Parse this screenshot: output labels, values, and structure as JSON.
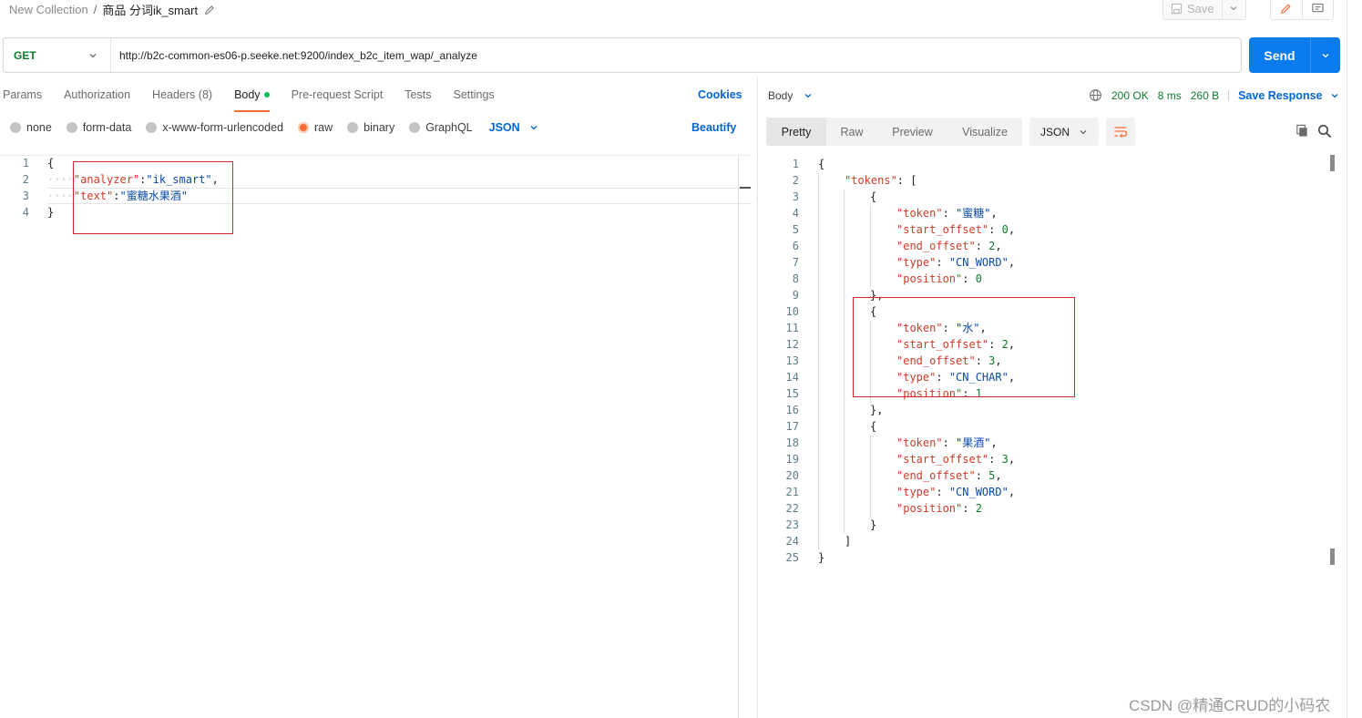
{
  "header": {
    "collection": "New Collection",
    "separator": "/",
    "request_name": "商品 分词ik_smart",
    "save_label": "Save"
  },
  "request": {
    "method": "GET",
    "url": "http://b2c-common-es06-p.seeke.net:9200/index_b2c_item_wap/_analyze",
    "send_label": "Send",
    "tabs": {
      "params": "Params",
      "authorization": "Authorization",
      "headers": "Headers",
      "headers_count": "(8)",
      "body": "Body",
      "pre_request": "Pre-request Script",
      "tests": "Tests",
      "settings": "Settings"
    },
    "cookies_label": "Cookies",
    "body_types": {
      "none": "none",
      "form_data": "form-data",
      "urlencoded": "x-www-form-urlencoded",
      "raw": "raw",
      "binary": "binary",
      "graphql": "GraphQL"
    },
    "selected_body_type": "raw",
    "raw_format": "JSON",
    "beautify_label": "Beautify",
    "line_numbers": [
      "1",
      "2",
      "3",
      "4"
    ],
    "code": {
      "open": "{",
      "line2_key": "\"analyzer\"",
      "line2_colon": ":",
      "line2_value": "\"ik_smart\"",
      "line2_comma": ",",
      "line3_key": "\"text\"",
      "line3_colon": ":",
      "line3_value": "\"蜜糖水果酒\"",
      "close": "}",
      "indent_dots": "····"
    }
  },
  "response": {
    "section_label": "Body",
    "status": "200 OK",
    "time": "8 ms",
    "size": "260 B",
    "save_response_label": "Save Response",
    "view_tabs": {
      "pretty": "Pretty",
      "raw": "Raw",
      "preview": "Preview",
      "visualize": "Visualize"
    },
    "format": "JSON",
    "line_numbers": [
      "1",
      "2",
      "3",
      "4",
      "5",
      "6",
      "7",
      "8",
      "9",
      "10",
      "11",
      "12",
      "13",
      "14",
      "15",
      "16",
      "17",
      "18",
      "19",
      "20",
      "21",
      "22",
      "23",
      "24",
      "25"
    ],
    "keys": {
      "tokens": "\"tokens\"",
      "token": "\"token\"",
      "start_offset": "\"start_offset\"",
      "end_offset": "\"end_offset\"",
      "type": "\"type\"",
      "position": "\"position\""
    },
    "tokens": [
      {
        "token": "\"蜜糖\"",
        "start_offset": "0",
        "end_offset": "2",
        "type": "\"CN_WORD\"",
        "position": "0"
      },
      {
        "token": "\"水\"",
        "start_offset": "2",
        "end_offset": "3",
        "type": "\"CN_CHAR\"",
        "position": "1"
      },
      {
        "token": "\"果酒\"",
        "start_offset": "3",
        "end_offset": "5",
        "type": "\"CN_WORD\"",
        "position": "2"
      }
    ]
  },
  "watermark": "CSDN @精通CRUD的小码农",
  "colors": {
    "accent_orange": "#ff6c37",
    "send_blue": "#097bed",
    "link_blue": "#0265d2",
    "status_green": "#0f7a2f",
    "highlight_red": "#d9262c"
  }
}
